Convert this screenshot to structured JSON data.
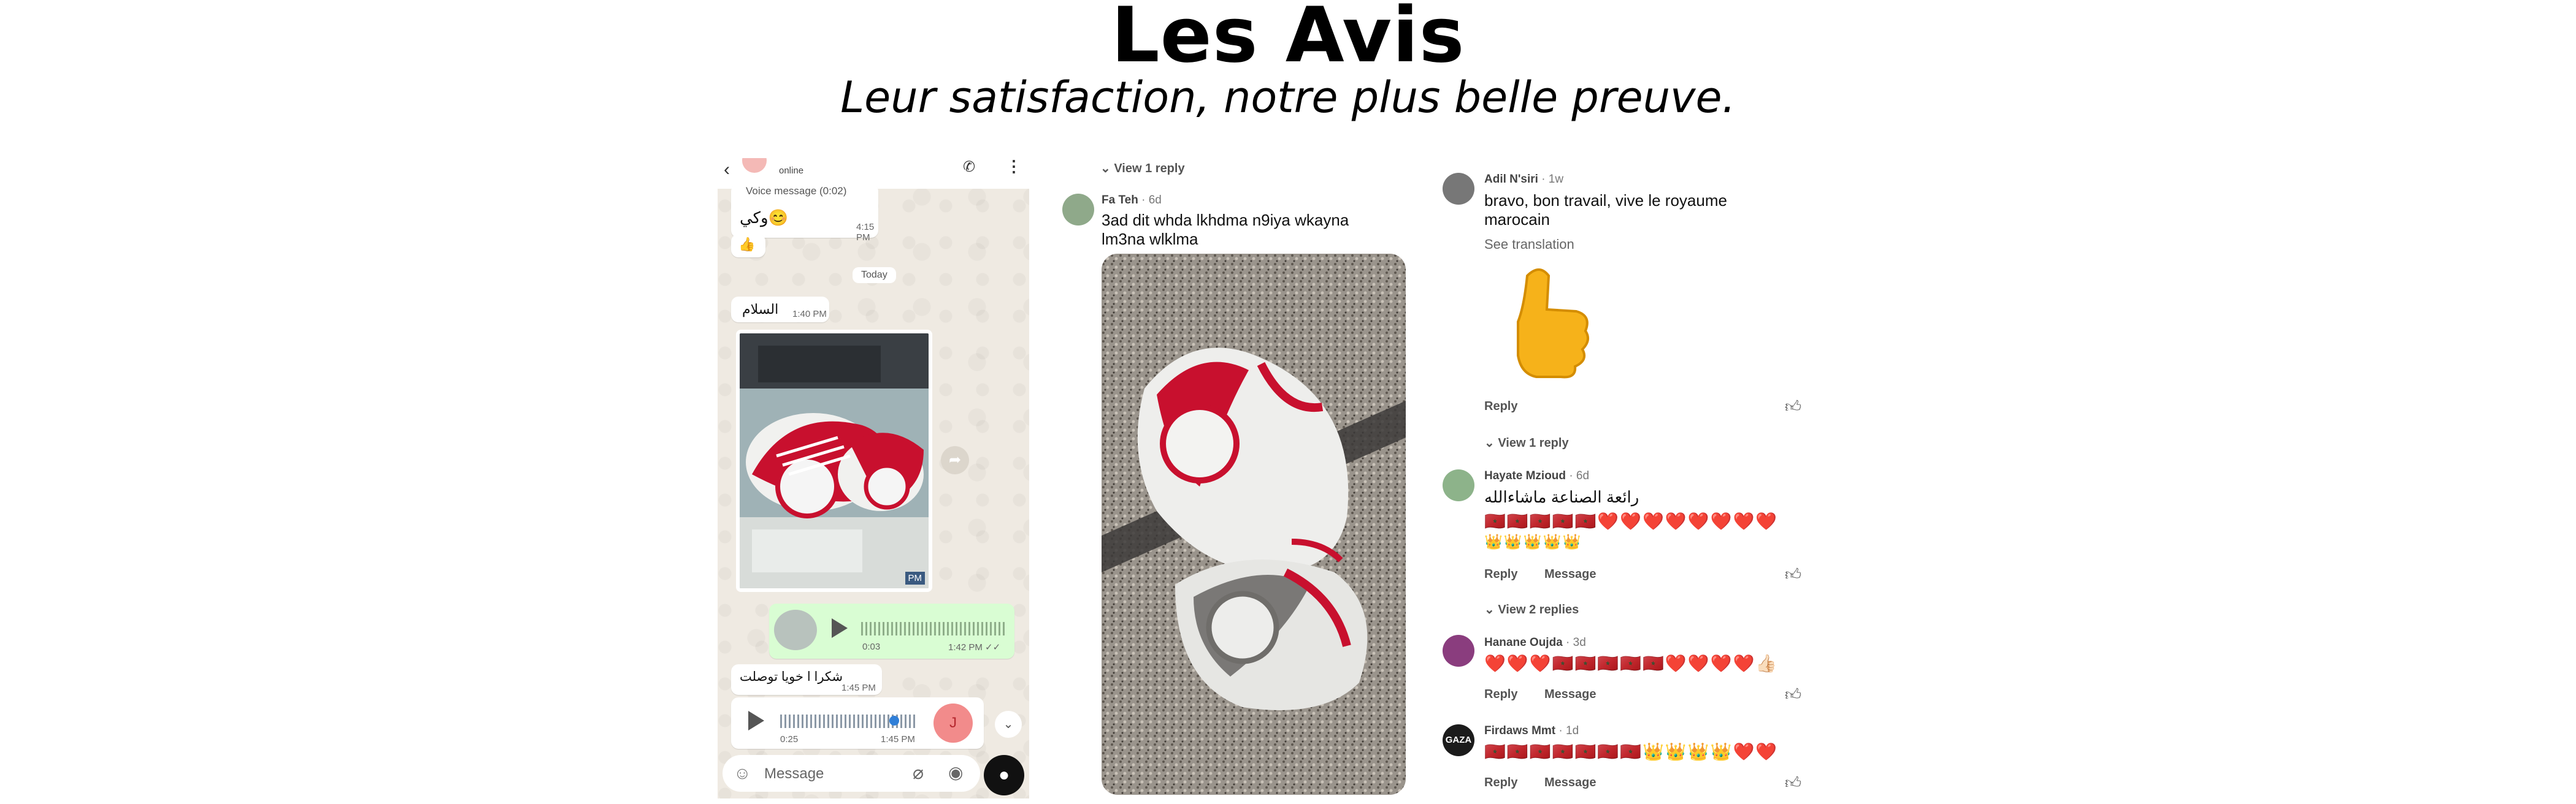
{
  "header": {
    "title": "Les Avis",
    "subtitle": "Leur satisfaction, notre plus belle preuve."
  },
  "whatsapp": {
    "status": "online",
    "voice_message_label": "Voice message (0:02)",
    "msg1_text": "وكي😊",
    "msg1_time": "4:15 PM",
    "msg2_emoji": "👍",
    "day_separator": "Today",
    "msg3_text": "السلام",
    "msg3_time": "1:40 PM",
    "photo_time": "PM",
    "voice1_duration": "0:03",
    "voice1_time": "1:42 PM ✓✓",
    "msg4_text": "شكرا ا خويا توصلت",
    "msg4_time": "1:45 PM",
    "voice2_duration": "0:25",
    "voice2_time": "1:45 PM",
    "voice2_avatar_initial": "J",
    "input_placeholder": "Message"
  },
  "comments_middle": {
    "view_reply": "View 1 reply",
    "author": "Fa Teh",
    "age": "· 6d",
    "text_line1": "3ad dit whda lkhdma n9iya wkayna",
    "text_line2": "lm3na wlklma"
  },
  "comments_right": [
    {
      "author": "Adil N'siri",
      "age": "· 1w",
      "text_line1": "bravo, bon travail, vive le royaume",
      "text_line2": "marocain",
      "see_translation": "See translation",
      "reply": "Reply",
      "view_replies": "View 1 reply"
    },
    {
      "author": "Hayate Mzioud",
      "age": "· 6d",
      "text": "رائعة الصناعة ماشاءالله",
      "emoji_line1": "🇲🇦🇲🇦🇲🇦🇲🇦🇲🇦❤️❤️❤️❤️❤️❤️❤️❤️",
      "emoji_line2": "👑👑👑👑👑",
      "reply": "Reply",
      "message": "Message",
      "view_replies": "View 2 replies"
    },
    {
      "author": "Hanane Oujda",
      "age": "· 3d",
      "emoji_line1": "❤️❤️❤️🇲🇦🇲🇦🇲🇦🇲🇦🇲🇦❤️❤️❤️❤️👍🏻",
      "reply": "Reply",
      "message": "Message"
    },
    {
      "author": "Firdaws Mmt",
      "age": "· 1d",
      "avatar_text": "GAZA",
      "emoji_line1": "🇲🇦🇲🇦🇲🇦🇲🇦🇲🇦🇲🇦🇲🇦👑👑👑👑❤️❤️",
      "reply": "Reply",
      "message": "Message"
    }
  ],
  "colors": {
    "whatsapp_bg": "#efeae2",
    "whatsapp_green_bubble": "#d9fdd3",
    "sneaker_red": "#c8102e",
    "heart_red": "#e02424"
  }
}
